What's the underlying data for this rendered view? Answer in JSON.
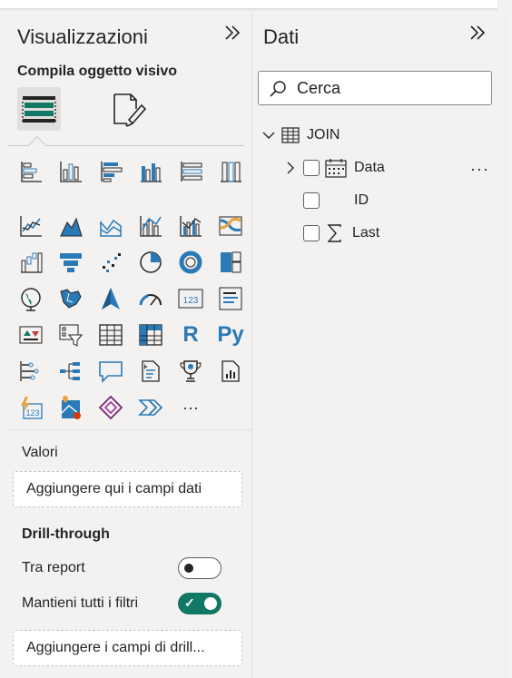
{
  "visualizations": {
    "title": "Visualizzazioni",
    "subtitle": "Compila oggetto visivo",
    "collapse_icon": "double-chevron-right-icon",
    "mode_buttons": [
      "build-visual-icon",
      "format-visual-icon"
    ],
    "visual_types": [
      "stacked-bar-chart-icon",
      "stacked-column-chart-icon",
      "clustered-bar-chart-icon",
      "clustered-column-chart-icon",
      "100-stacked-bar-chart-icon",
      "100-stacked-column-chart-icon",
      "line-chart-icon",
      "area-chart-icon",
      "stacked-area-chart-icon",
      "line-and-stacked-column-icon",
      "line-and-clustered-column-icon",
      "ribbon-chart-icon",
      "waterfall-chart-icon",
      "funnel-chart-icon",
      "scatter-chart-icon",
      "pie-chart-icon",
      "donut-chart-icon",
      "treemap-icon",
      "map-icon",
      "filled-map-icon",
      "azure-map-icon",
      "gauge-icon",
      "card-icon",
      "multi-row-card-icon",
      "kpi-icon",
      "slicer-icon",
      "table-icon",
      "matrix-icon",
      "r-visual-icon",
      "python-visual-icon",
      "key-influencers-icon",
      "decomposition-tree-icon",
      "qa-icon",
      "smart-narrative-icon",
      "metrics-icon",
      "paginated-report-icon",
      "power-apps-icon",
      "arcgis-map-icon",
      "power-automate-icon",
      "power-bi-flow-icon",
      "more-visuals-icon"
    ],
    "r_text": "R",
    "py_text": "Py",
    "card_text": "123",
    "more_text": "···",
    "values_section": {
      "label": "Valori",
      "placeholder": "Aggiungere qui i campi dati"
    },
    "drillthrough": {
      "heading": "Drill-through",
      "cross_report_label": "Tra report",
      "cross_report_on": false,
      "keep_filters_label": "Mantieni tutti i filtri",
      "keep_filters_on": true,
      "placeholder": "Aggiungere i campi di drill..."
    }
  },
  "data_pane": {
    "title": "Dati",
    "collapse_icon": "double-chevron-right-icon",
    "search": {
      "placeholder": "Cerca"
    },
    "table": {
      "name": "JOIN",
      "expanded": true,
      "fields": [
        {
          "name": "Data",
          "icon": "calendar-hierarchy-icon",
          "expandable": true
        },
        {
          "name": "ID",
          "icon": "",
          "expandable": false
        },
        {
          "name": "Last",
          "icon": "sigma-icon",
          "expandable": false
        }
      ]
    },
    "more_options": "···"
  },
  "colors": {
    "accent": "#117865",
    "icon_blue": "#2b7ab8",
    "icon_dark": "#252423",
    "background": "#f3f2f1"
  }
}
